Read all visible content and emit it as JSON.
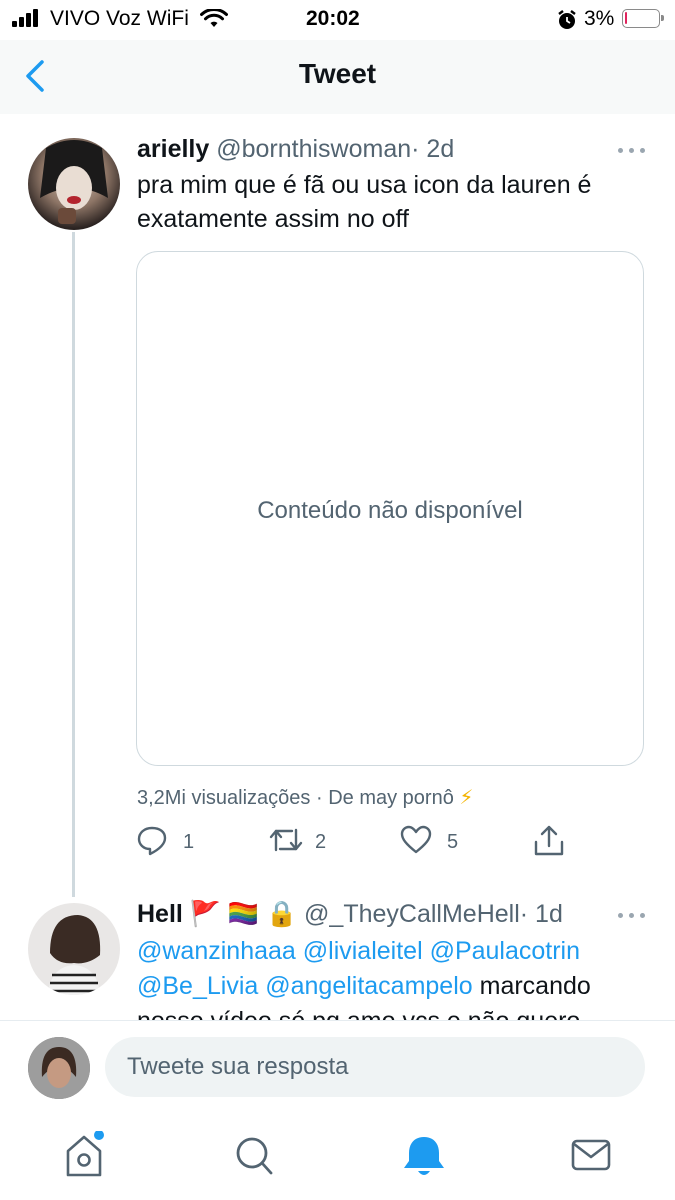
{
  "status_bar": {
    "carrier": "VIVO Voz WiFi",
    "time": "20:02",
    "battery": "3%",
    "battery_level": 0.03
  },
  "header": {
    "title": "Tweet"
  },
  "tweet": {
    "author_name": "arielly",
    "author_handle": "@bornthiswoman",
    "age": "· 2d",
    "text": "pra mim que é fã ou usa icon da lauren é exatamente assim no off",
    "media_unavailable": "Conteúdo não disponível",
    "views": "3,2Mi visualizações",
    "source": "· De may pornô",
    "source_emoji": "⚡",
    "replies": "1",
    "retweets": "2",
    "likes": "5"
  },
  "reply": {
    "author_name": "Hell",
    "name_emojis": "🚩 🏳️‍🌈 🔒",
    "author_handle": "@_TheyCallMeHell",
    "age": "· 1d",
    "mentions_line1": "@wanzinhaaa @livialeitel @Paulacotrin",
    "mentions_line2": "@Be_Livia @angelitacampelo",
    "text_line2": " marcando",
    "text_line3": "nosso vídeo só pq amo vcs e não quero"
  },
  "composer": {
    "placeholder": "Tweete sua resposta"
  },
  "colors": {
    "accent": "#1d9bf0",
    "secondary_text": "#536471",
    "border": "#cfd9de"
  },
  "icons": [
    "back-chevron-icon",
    "more-icon",
    "reply-icon",
    "retweet-icon",
    "like-icon",
    "share-icon",
    "home-icon",
    "search-icon",
    "notifications-icon",
    "messages-icon"
  ]
}
